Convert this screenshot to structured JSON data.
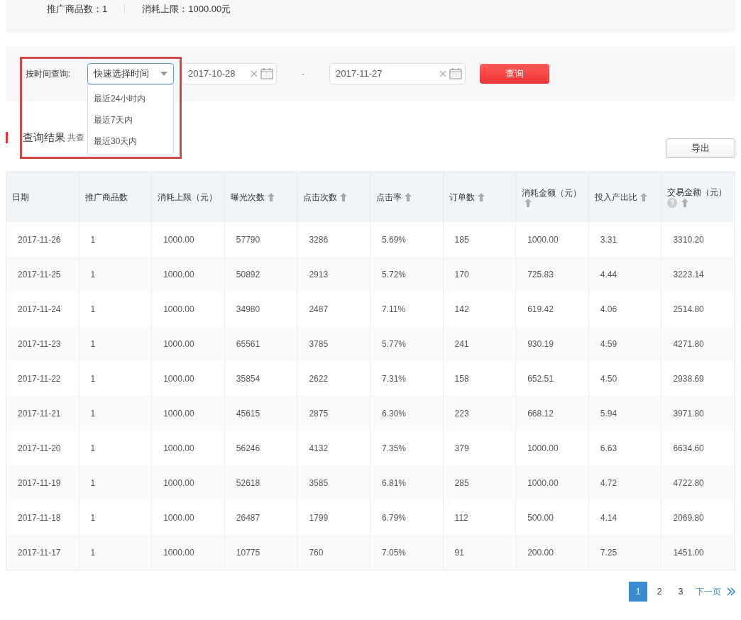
{
  "summary": {
    "products": "推广商品数：1",
    "limit": "消耗上限：1000.00元"
  },
  "filter": {
    "label": "按时间查询:",
    "select": {
      "value": "快速选择时间",
      "expanded": true,
      "options": [
        "最近24小时内",
        "最近7天内",
        "最近30天内"
      ]
    },
    "start_date": "2017-10-28",
    "separator": "-",
    "end_date": "2017-11-27",
    "button": "查询"
  },
  "results": {
    "title": "查询结果",
    "summary": "共查",
    "export": "导出"
  },
  "table": {
    "columns": [
      {
        "label": "日期",
        "sortable": false
      },
      {
        "label": "推广商品数",
        "sortable": false
      },
      {
        "label": "消耗上限（元）",
        "sortable": false
      },
      {
        "label": "曝光次数",
        "sortable": true
      },
      {
        "label": "点击次数",
        "sortable": true
      },
      {
        "label": "点击率",
        "sortable": true
      },
      {
        "label": "订单数",
        "sortable": true
      },
      {
        "label": "消耗金额（元）",
        "sortable": true
      },
      {
        "label": "投入产出比",
        "sortable": true
      },
      {
        "label": "交易金额（元）",
        "sortable": true,
        "help": true
      }
    ],
    "rows": [
      [
        "2017-11-26",
        "1",
        "1000.00",
        "57790",
        "3286",
        "5.69%",
        "185",
        "1000.00",
        "3.31",
        "3310.20"
      ],
      [
        "2017-11-25",
        "1",
        "1000.00",
        "50892",
        "2913",
        "5.72%",
        "170",
        "725.83",
        "4.44",
        "3223.14"
      ],
      [
        "2017-11-24",
        "1",
        "1000.00",
        "34980",
        "2487",
        "7.11%",
        "142",
        "619.42",
        "4.06",
        "2514.80"
      ],
      [
        "2017-11-23",
        "1",
        "1000.00",
        "65561",
        "3785",
        "5.77%",
        "241",
        "930.19",
        "4.59",
        "4271.80"
      ],
      [
        "2017-11-22",
        "1",
        "1000.00",
        "35854",
        "2622",
        "7.31%",
        "158",
        "652.51",
        "4.50",
        "2938.69"
      ],
      [
        "2017-11-21",
        "1",
        "1000.00",
        "45615",
        "2875",
        "6.30%",
        "223",
        "668.12",
        "5.94",
        "3971.80"
      ],
      [
        "2017-11-20",
        "1",
        "1000.00",
        "56246",
        "4132",
        "7.35%",
        "379",
        "1000.00",
        "6.63",
        "6634.60"
      ],
      [
        "2017-11-19",
        "1",
        "1000.00",
        "52618",
        "3585",
        "6.81%",
        "285",
        "1000.00",
        "4.72",
        "4722.80"
      ],
      [
        "2017-11-18",
        "1",
        "1000.00",
        "26487",
        "1799",
        "6.79%",
        "112",
        "500.00",
        "4.14",
        "2069.80"
      ],
      [
        "2017-11-17",
        "1",
        "1000.00",
        "10775",
        "760",
        "7.05%",
        "91",
        "200.00",
        "7.25",
        "1451.00"
      ]
    ]
  },
  "pagination": {
    "pages": [
      {
        "label": "1",
        "selected": true
      },
      {
        "label": "2",
        "selected": false
      },
      {
        "label": "3",
        "selected": false
      }
    ],
    "next": "下一页"
  },
  "annotation": {
    "highlight": true
  }
}
